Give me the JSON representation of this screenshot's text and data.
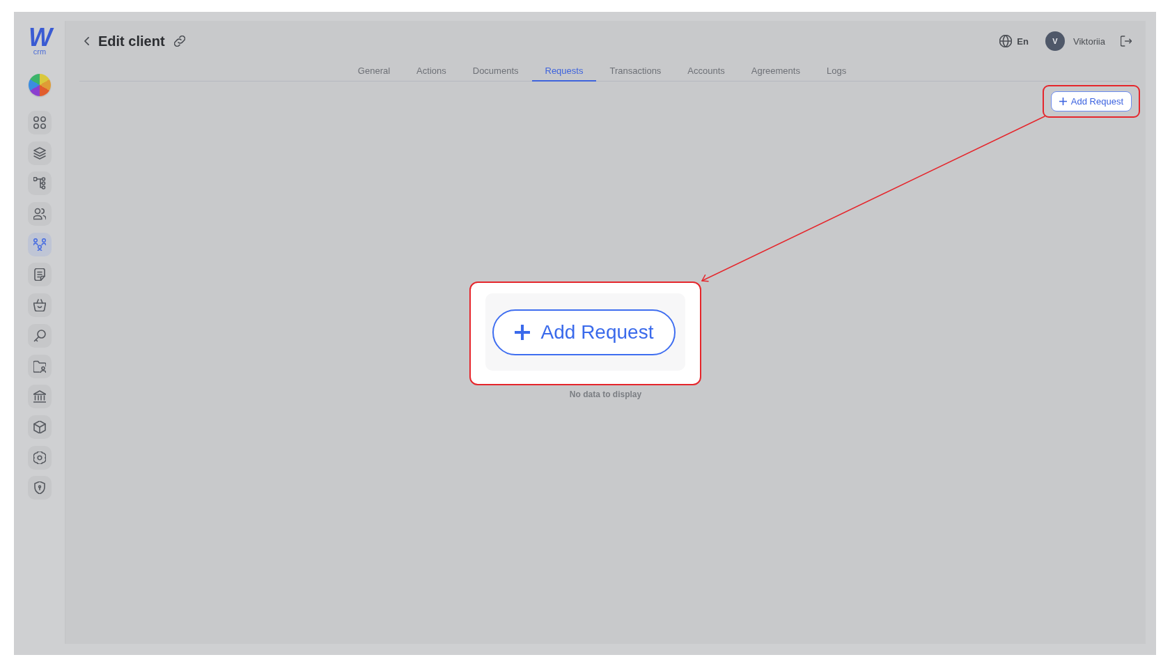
{
  "sidebar": {
    "logo": {
      "mark": "W",
      "caption": "crm"
    },
    "items": [
      {
        "selected": false
      },
      {
        "selected": false
      },
      {
        "selected": false
      },
      {
        "selected": false
      },
      {
        "selected": true
      },
      {
        "selected": false
      },
      {
        "selected": false
      },
      {
        "selected": false
      },
      {
        "selected": false
      },
      {
        "selected": false
      },
      {
        "selected": false
      },
      {
        "selected": false
      },
      {
        "selected": false
      }
    ]
  },
  "header": {
    "title": "Edit client",
    "language": "En",
    "user": {
      "initial": "V",
      "name": "Viktoriia"
    }
  },
  "tabs": [
    {
      "label": "General",
      "selected": false
    },
    {
      "label": "Actions",
      "selected": false
    },
    {
      "label": "Documents",
      "selected": false
    },
    {
      "label": "Requests",
      "selected": true
    },
    {
      "label": "Transactions",
      "selected": false
    },
    {
      "label": "Accounts",
      "selected": false
    },
    {
      "label": "Agreements",
      "selected": false
    },
    {
      "label": "Logs",
      "selected": false
    }
  ],
  "toolbar": {
    "add_button": {
      "label": "Add Request"
    }
  },
  "empty_state": {
    "message": "No data to display"
  },
  "callout": {
    "button": {
      "label": "Add Request"
    }
  }
}
